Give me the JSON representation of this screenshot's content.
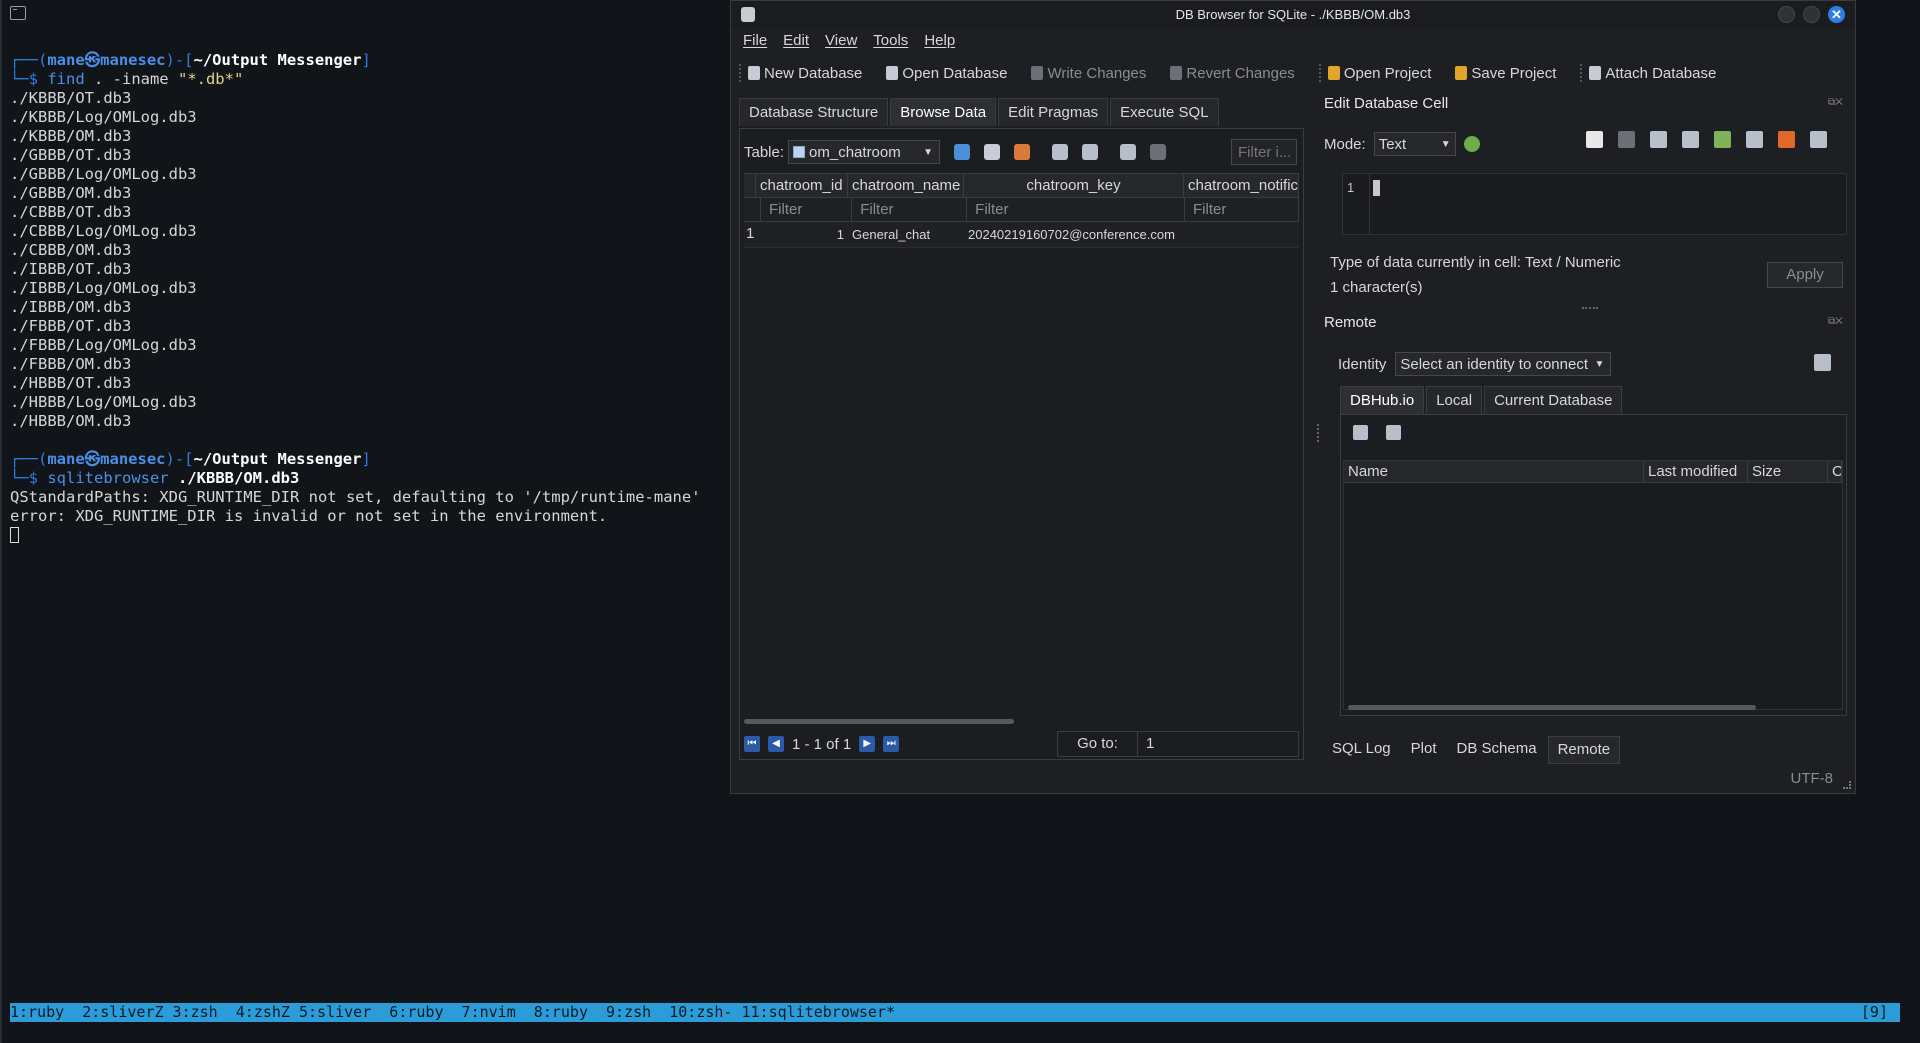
{
  "terminal": {
    "prompt1": {
      "open": "┌──(",
      "user": "mane",
      "at": "㉿",
      "host": "manesec",
      "mid": ")-[",
      "path": "~/Output Messenger",
      "close": "]"
    },
    "cmd1": {
      "prefix": "└─$ ",
      "cmd": "find",
      "args": " . -iname ",
      "str": "\"*.db*\""
    },
    "output1": [
      "./KBBB/OT.db3",
      "./KBBB/Log/OMLog.db3",
      "./KBBB/OM.db3",
      "./GBBB/OT.db3",
      "./GBBB/Log/OMLog.db3",
      "./GBBB/OM.db3",
      "./CBBB/OT.db3",
      "./CBBB/Log/OMLog.db3",
      "./CBBB/OM.db3",
      "./IBBB/OT.db3",
      "./IBBB/Log/OMLog.db3",
      "./IBBB/OM.db3",
      "./FBBB/OT.db3",
      "./FBBB/Log/OMLog.db3",
      "./FBBB/OM.db3",
      "./HBBB/OT.db3",
      "./HBBB/Log/OMLog.db3",
      "./HBBB/OM.db3"
    ],
    "prompt2": {
      "open": "┌──(",
      "user": "mane",
      "at": "㉿",
      "host": "manesec",
      "mid": ")-[",
      "path": "~/Output Messenger",
      "close": "]"
    },
    "cmd2": {
      "prefix": "└─$ ",
      "cmd": "sqlitebrowser",
      "args": " ",
      "path": "./KBBB/OM.db3"
    },
    "output2": [
      "QStandardPaths: XDG_RUNTIME_DIR not set, defaulting to '/tmp/runtime-mane'",
      "error: XDG_RUNTIME_DIR is invalid or not set in the environment."
    ]
  },
  "tmux": {
    "windows": "1:ruby  2:sliverZ 3:zsh  4:zshZ 5:sliver  6:ruby  7:nvim  8:ruby  9:zsh  10:zsh- 11:sqlitebrowser*",
    "right": "[9]"
  },
  "window": {
    "title": "DB Browser for SQLite - ./KBBB/OM.db3",
    "close_glyph": "✕"
  },
  "menu": [
    "File",
    "Edit",
    "View",
    "Tools",
    "Help"
  ],
  "toolbar": {
    "new_database": "New Database",
    "open_database": "Open Database",
    "write_changes": "Write Changes",
    "revert_changes": "Revert Changes",
    "open_project": "Open Project",
    "save_project": "Save Project",
    "attach_database": "Attach Database"
  },
  "main_tabs": [
    "Database Structure",
    "Browse Data",
    "Edit Pragmas",
    "Execute SQL"
  ],
  "browse": {
    "table_label": "Table:",
    "table_name": "om_chatroom",
    "filter_placeholder": "Filter i...",
    "columns": [
      "chatroom_id",
      "chatroom_name",
      "chatroom_key",
      "chatroom_notifica"
    ],
    "filter_cells": [
      "Filter",
      "Filter",
      "Filter",
      "Filter"
    ],
    "rows": [
      {
        "rownum": "1",
        "chatroom_id": "1",
        "chatroom_name": "General_chat",
        "chatroom_key": "20240219160702@conference.com",
        "chatroom_notifica": ""
      }
    ],
    "pager_text": "1 - 1 of 1",
    "goto_label": "Go to:",
    "goto_value": "1"
  },
  "edit_cell": {
    "heading": "Edit Database Cell",
    "mode_label": "Mode:",
    "mode_value": "Text",
    "line_number": "1",
    "type_text": "Type of data currently in cell: Text / Numeric",
    "size_text": "1 character(s)",
    "apply": "Apply"
  },
  "remote": {
    "heading": "Remote",
    "identity_label": "Identity",
    "identity_value": "Select an identity to connect",
    "tabs": [
      "DBHub.io",
      "Local",
      "Current Database"
    ],
    "columns": [
      "Name",
      "Last modified",
      "Size",
      "C"
    ]
  },
  "bottom_tabs": [
    "SQL Log",
    "Plot",
    "DB Schema",
    "Remote"
  ],
  "encoding": "UTF-8"
}
